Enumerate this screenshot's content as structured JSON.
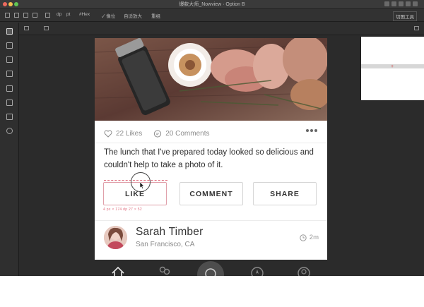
{
  "window": {
    "title": "爆款大师_Nowview · Option B"
  },
  "options_bar": {
    "items": [
      "dp",
      "pt",
      "#Hex",
      "✓ 像位",
      "自适放大",
      "重组"
    ],
    "right_button": "切图工具"
  },
  "post": {
    "likes": "22 Likes",
    "comments": "20 Comments",
    "caption": "The lunch that I've prepared today looked so delicious and couldn't help to take a photo of it.",
    "buttons": {
      "like": "LIKE",
      "comment": "COMMENT",
      "share": "SHARE"
    },
    "measure_label": "4 px  × 174 dp  27 × 52",
    "author": {
      "name": "Sarah Timber",
      "location": "San Francisco, CA"
    },
    "time": "2m"
  },
  "icons": {
    "toolbar": [
      "artboard-tool-icon",
      "move-tool-icon",
      "ruler-tool-icon",
      "frame-tool-icon",
      "brush-tool-icon",
      "annotation-tool-icon",
      "plus-tool-icon",
      "bug-tool-icon"
    ],
    "bottom_nav": [
      "home-icon",
      "people-icon",
      "chat-icon",
      "location-icon",
      "profile-icon"
    ]
  },
  "colors": {
    "canvas": "#2b2b2b",
    "accent_selection": "#e07080"
  }
}
